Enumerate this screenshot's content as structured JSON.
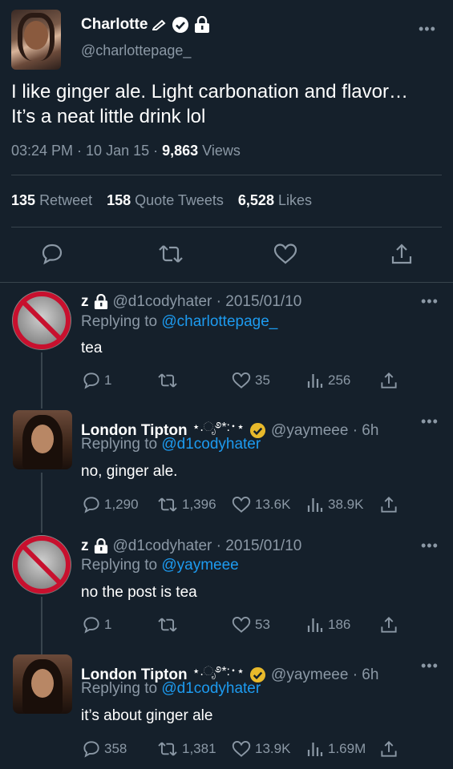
{
  "main_tweet": {
    "display_name": "Charlotte",
    "handle": "@charlottepage_",
    "text": "I like ginger ale. Light carbonation and flavor… It’s a neat little drink lol",
    "time": "03:24 PM · 10 Jan 15 · ",
    "views_count": "9,863",
    "views_label": " Views",
    "retweets": "135",
    "retweets_label": "Retweet",
    "quote_tweets": "158",
    "quote_tweets_label": "Quote Tweets",
    "likes": "6,528",
    "likes_label": "Likes"
  },
  "replies": [
    {
      "name": "z",
      "handle_date": "@d1codyhater · 2015/01/10",
      "replying_prefix": "Replying to ",
      "replying_to": "@charlottepage_",
      "text": "tea",
      "replies": "1",
      "retweets": "",
      "likes": "35",
      "views": "256"
    },
    {
      "name": "London Tipton",
      "sparkles": "⋆.ೃ࿔*:･⋆",
      "handle_date": "@yaymeee · 6h",
      "replying_prefix": "Replying to ",
      "replying_to": "@d1codyhater",
      "text": "no, ginger ale.",
      "replies": "1,290",
      "retweets": "1,396",
      "likes": "13.6K",
      "views": "38.9K"
    },
    {
      "name": "z",
      "handle_date": "@d1codyhater · 2015/01/10",
      "replying_prefix": "Replying to ",
      "replying_to": "@yaymeee",
      "text": "no the post is tea",
      "replies": "1",
      "retweets": "",
      "likes": "53",
      "views": "186"
    },
    {
      "name": "London Tipton",
      "sparkles": "⋆.ೃ࿔*:･⋆",
      "handle_date": "@yaymeee · 6h",
      "replying_prefix": "Replying to ",
      "replying_to": "@d1codyhater",
      "text": "it’s about ginger ale",
      "replies": "358",
      "retweets": "1,381",
      "likes": "13.9K",
      "views": "1.69M"
    }
  ],
  "more_label": "•••",
  "colors": {
    "background": "#15202b",
    "muted": "#8b98a5",
    "link": "#1d9bf0",
    "verified": "#ffffff",
    "gold_badge": "#e8b92b"
  }
}
